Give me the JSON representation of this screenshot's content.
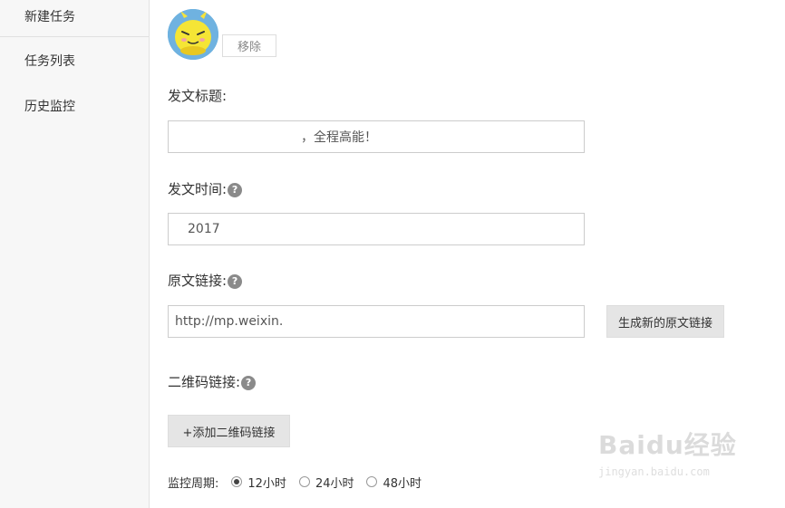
{
  "sidebar": {
    "items": [
      {
        "label": "新建任务"
      },
      {
        "label": "任务列表"
      },
      {
        "label": "历史监控"
      }
    ]
  },
  "account": {
    "remove_label": "移除"
  },
  "form": {
    "title_label": "发文标题:",
    "title_value": "，全程高能！",
    "time_label": "发文时间:",
    "time_value": "2017",
    "link_label": "原文链接:",
    "link_value": "http://mp.weixin.",
    "generate_link_label": "生成新的原文链接",
    "qr_label": "二维码链接:",
    "add_qr_label": "+添加二维码链接",
    "period_label": "监控周期:",
    "period_options": [
      {
        "label": "12小时",
        "selected": true
      },
      {
        "label": "24小时",
        "selected": false
      },
      {
        "label": "48小时",
        "selected": false
      }
    ],
    "help_glyph": "?"
  },
  "watermark": {
    "brand": "Baidu经验",
    "url": "jingyan.baidu.com"
  },
  "colors": {
    "sidebar_bg": "#f7f7f7",
    "button_gray": "#e5e5e5",
    "help_icon": "#8a8a8a"
  }
}
